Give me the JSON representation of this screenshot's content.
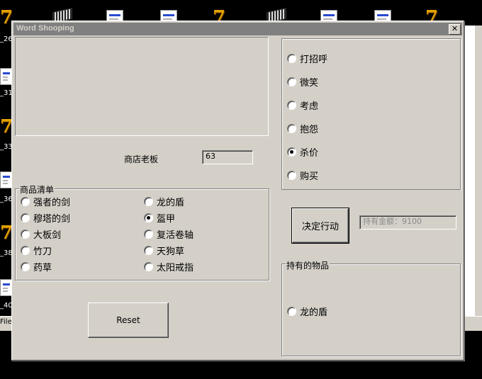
{
  "desktop": {
    "labels": [
      "_26",
      "_31",
      "_33",
      "_36",
      "_38",
      "_40"
    ],
    "status_text": "File"
  },
  "window": {
    "title": "Word Shooping",
    "close_glyph": "✕"
  },
  "shop": {
    "owner_label": "商店老板",
    "owner_value": "63"
  },
  "goods": {
    "legend": "商品清单",
    "items": [
      {
        "label": "强者的剑",
        "selected": false
      },
      {
        "label": "穆塔的剑",
        "selected": false
      },
      {
        "label": "大板剑",
        "selected": false
      },
      {
        "label": "竹刀",
        "selected": false
      },
      {
        "label": "药草",
        "selected": false
      },
      {
        "label": "龙的盾",
        "selected": false
      },
      {
        "label": "盔甲",
        "selected": true
      },
      {
        "label": "复活卷轴",
        "selected": false
      },
      {
        "label": "天狗草",
        "selected": false
      },
      {
        "label": "太阳戒指",
        "selected": false
      }
    ]
  },
  "actions": {
    "options": [
      {
        "label": "打招呼",
        "selected": false
      },
      {
        "label": "微笑",
        "selected": false
      },
      {
        "label": "考虑",
        "selected": false
      },
      {
        "label": "抱怨",
        "selected": false
      },
      {
        "label": "杀价",
        "selected": true
      },
      {
        "label": "购买",
        "selected": false
      }
    ]
  },
  "decide_button": "决定行动",
  "money_text": "持有金额：9100",
  "inventory": {
    "legend": "持有的物品",
    "items": [
      {
        "label": "龙的盾",
        "selected": false
      }
    ]
  },
  "reset_button": "Reset"
}
